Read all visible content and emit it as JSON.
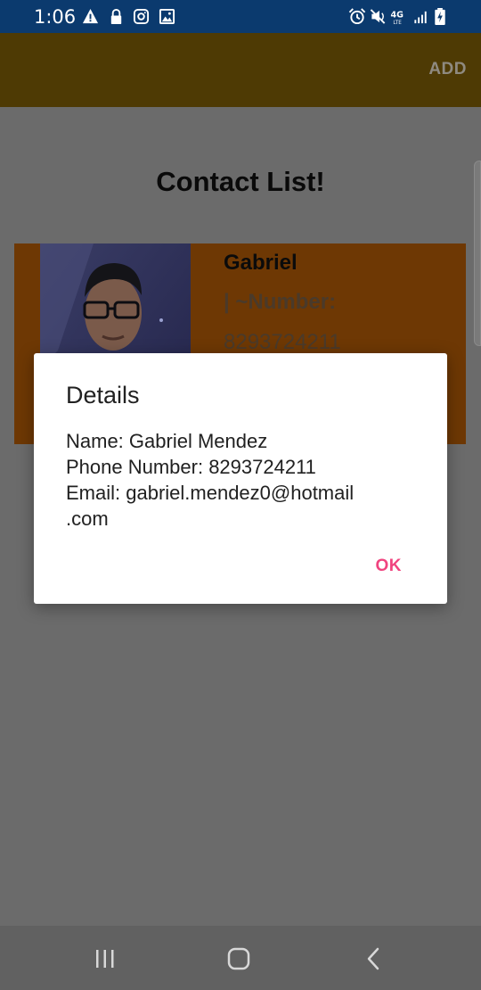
{
  "status_bar": {
    "time": "1:06",
    "icons_left": [
      "warning-icon",
      "lock-icon",
      "instagram-icon",
      "image-icon"
    ],
    "icons_right": [
      "alarm-icon",
      "mute-icon",
      "4g-lte-icon",
      "signal-icon",
      "battery-charging-icon"
    ]
  },
  "app_bar": {
    "action_label": "ADD"
  },
  "content": {
    "title": "Contact List!",
    "contacts": [
      {
        "name": "Gabriel",
        "number_label": "| ~Number:",
        "number": "8293724211",
        "card_color": "#6e3804"
      }
    ]
  },
  "dialog": {
    "title": "Details",
    "lines": [
      "Name: Gabriel Mendez",
      "Phone Number: 8293724211",
      "Email: gabriel.mendez0@hotmail",
      ".com"
    ],
    "ok_label": "OK",
    "accent_color": "#f0447f"
  },
  "nav_bar": {
    "buttons": [
      "recent-apps-icon",
      "home-icon",
      "back-icon"
    ]
  }
}
